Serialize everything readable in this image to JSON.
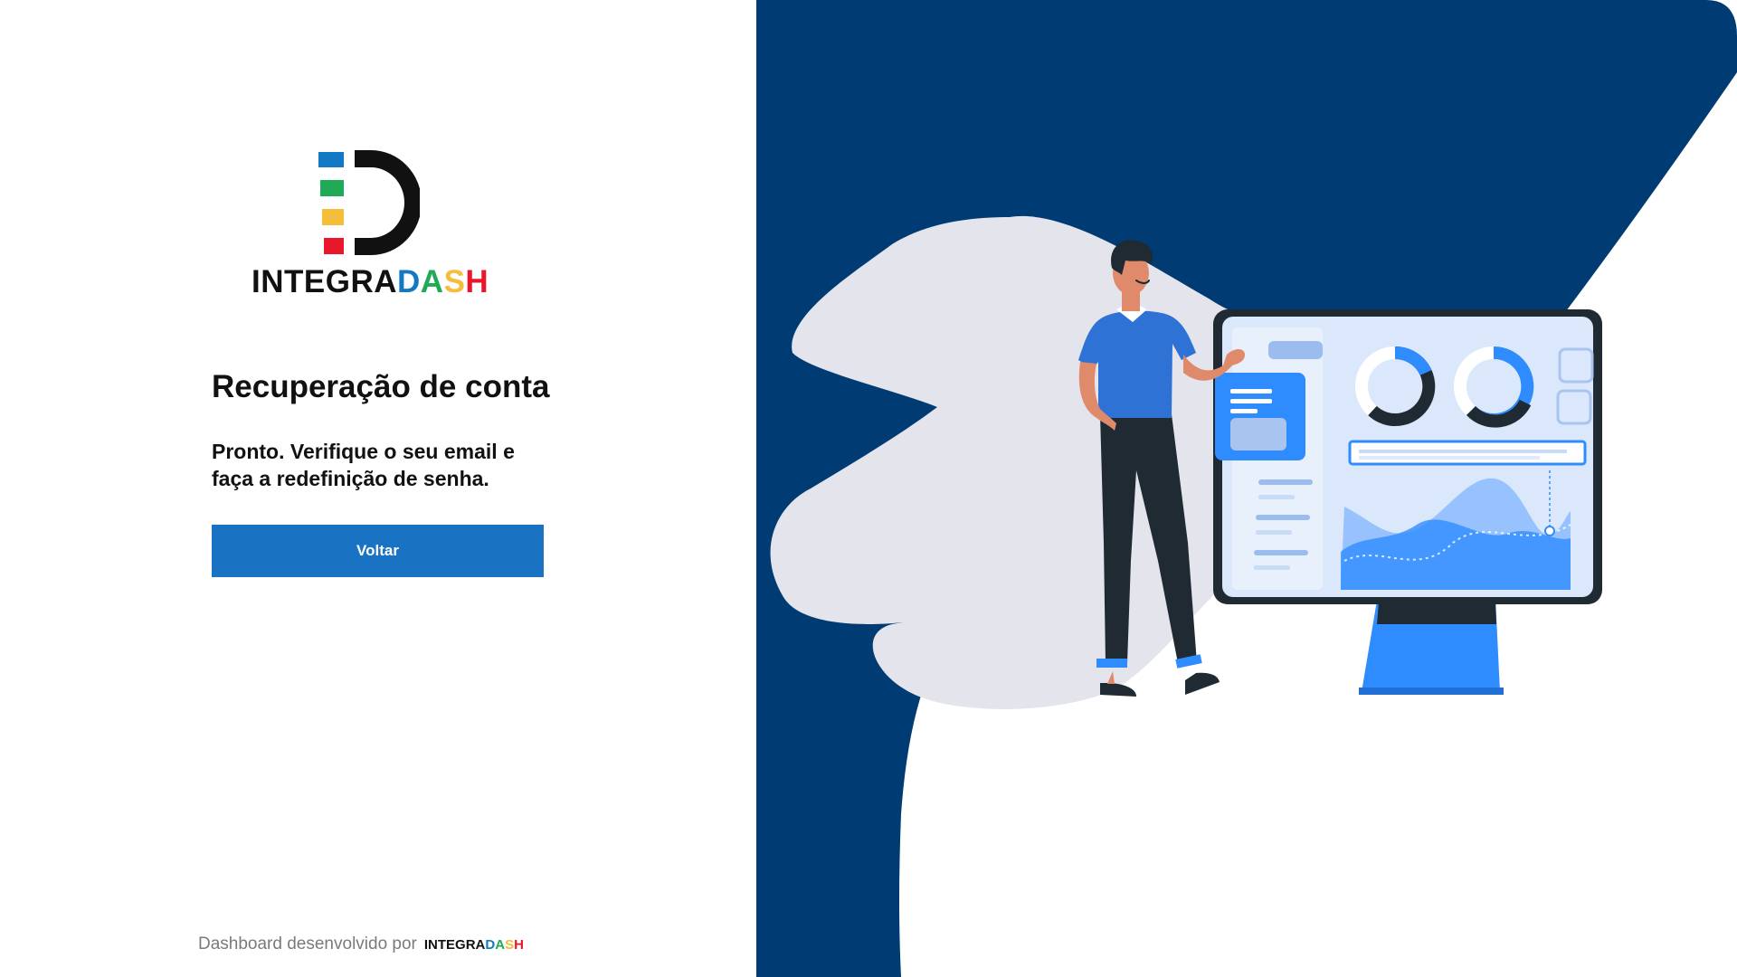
{
  "brand": {
    "name_base": "INTEGRA",
    "name_colored": [
      "D",
      "A",
      "S",
      "H"
    ],
    "colors": {
      "blue": "#1479c4",
      "green": "#1faa55",
      "yellow": "#f5bd3a",
      "red": "#e8172a",
      "dark": "#111111"
    }
  },
  "recovery": {
    "title": "Recuperação de conta",
    "message": "Pronto. Verifique o seu email e faça a redefinição de senha.",
    "back_label": "Voltar"
  },
  "footer": {
    "text": "Dashboard desenvolvido por",
    "brand_base": "INTEGRA",
    "brand_colored": [
      "D",
      "A",
      "S",
      "H"
    ]
  },
  "theme": {
    "primary_button": "#1a73c2",
    "panel_navy": "#003b73",
    "illustration_accent": "#2f8cff"
  },
  "illustration": {
    "icon": "person-presenting-dashboard-illustration"
  }
}
